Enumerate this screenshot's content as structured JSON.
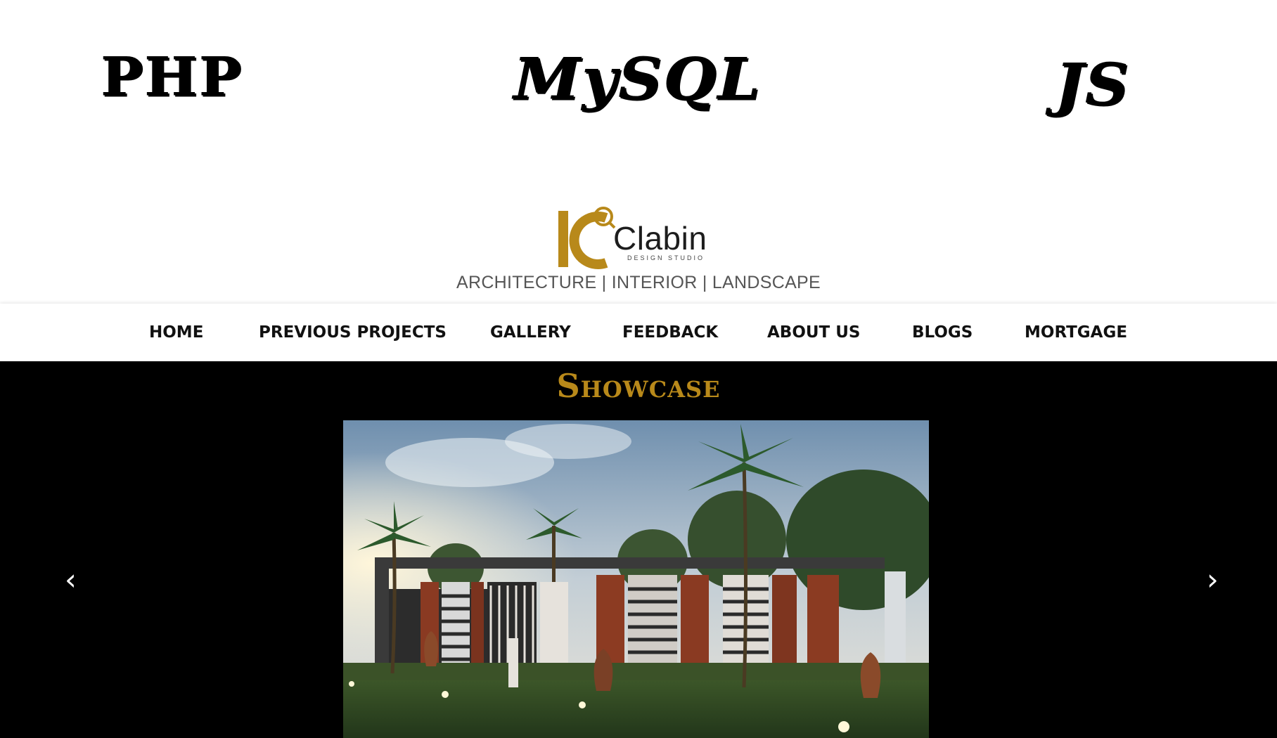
{
  "header_logos": {
    "items": [
      "PHP",
      "MySQL",
      "JS"
    ]
  },
  "brand": {
    "name": "Clabin",
    "subtitle": "DESIGN STUDIO",
    "tagline": "ARCHITECTURE | INTERIOR | LANDSCAPE",
    "accent_color": "#b8891a"
  },
  "nav": {
    "items": [
      {
        "label": "HOME"
      },
      {
        "label": "PREVIOUS PROJECTS"
      },
      {
        "label": "GALLERY"
      },
      {
        "label": "FEEDBACK"
      },
      {
        "label": "ABOUT US"
      },
      {
        "label": "BLOGS"
      },
      {
        "label": "MORTGAGE"
      }
    ]
  },
  "showcase": {
    "title": "Showcase",
    "prev_icon": "‹",
    "next_icon": "›",
    "title_color": "#b8891a"
  }
}
